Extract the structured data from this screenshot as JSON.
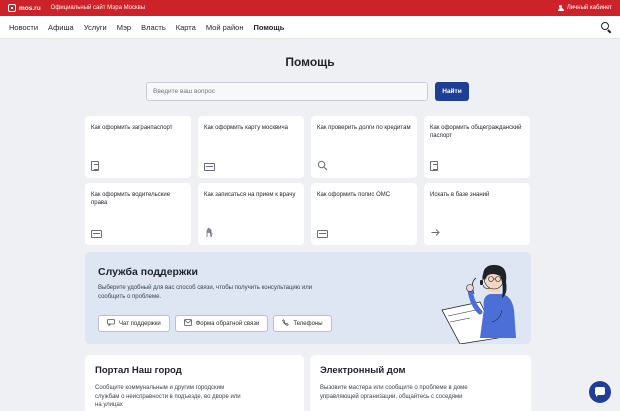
{
  "topbar": {
    "logo": "mos.ru",
    "official": "Официальный сайт Мэра Москвы",
    "cabinet": "Личный кабинет"
  },
  "nav": {
    "items": [
      "Новости",
      "Афиша",
      "Услуги",
      "Мэр",
      "Власть",
      "Карта",
      "Мой район",
      "Помощь"
    ],
    "active": "Помощь"
  },
  "page": {
    "title": "Помощь"
  },
  "search": {
    "placeholder": "Введите ваш вопрос",
    "value": "",
    "button": "Найти"
  },
  "cards": [
    {
      "label": "Как оформить загранпаспорт",
      "icon": "passport-icon"
    },
    {
      "label": "Как оформить карту москвича",
      "icon": "card-icon"
    },
    {
      "label": "Как проверить долги по кредитам",
      "icon": "magnifier-icon"
    },
    {
      "label": "Как оформить общегражданский паспорт",
      "icon": "passport-icon"
    },
    {
      "label": "Как оформить водительские права",
      "icon": "license-icon"
    },
    {
      "label": "Как записаться на прием к врачу",
      "icon": "hand-icon"
    },
    {
      "label": "Как оформить полис ОМС",
      "icon": "policy-icon"
    },
    {
      "label": "Искать в базе знаний",
      "icon": "arrow-right-icon"
    }
  ],
  "support": {
    "title": "Служба поддержки",
    "text": "Выберите удобный для вас способ связи, чтобы получить консультацию или сообщить о проблеме.",
    "buttons": [
      "Чат поддержки",
      "Форма обратной связи",
      "Телефоны"
    ]
  },
  "portal": {
    "title": "Портал Наш город",
    "text": "Сообщите коммунальным и другим городским службам о неисправности в подъезде, во дворе или на улицах"
  },
  "edom": {
    "title": "Электронный дом",
    "text": "Вызовите мастера или сообщите о проблеме в доме управляющей организации, общайтесь с соседями"
  },
  "colors": {
    "brand_red": "#cc2229",
    "accent_blue": "#1f3f97",
    "support_bg": "#dfe6f3"
  }
}
